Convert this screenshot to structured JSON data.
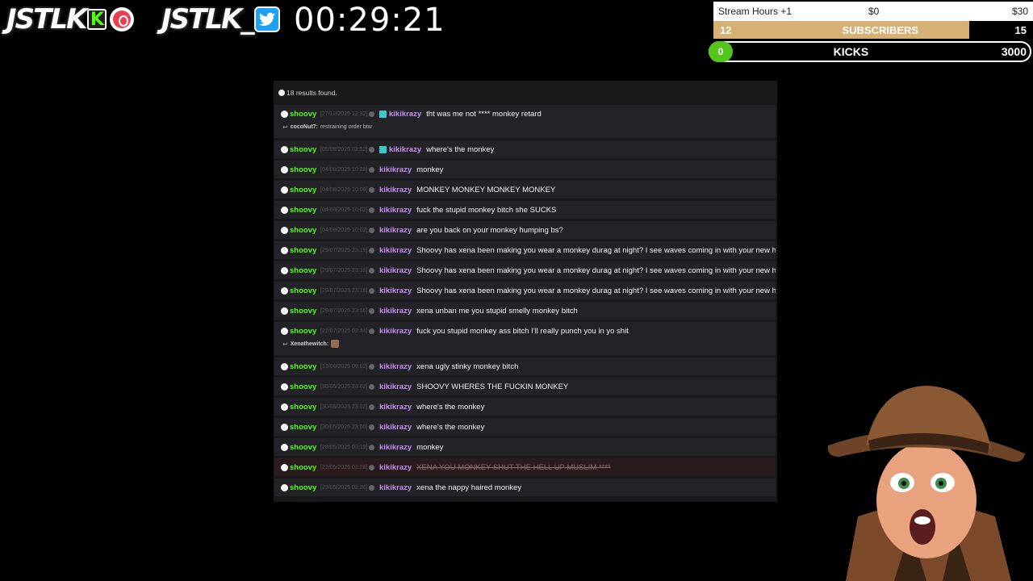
{
  "brand": {
    "logo1": "JSTLK",
    "logo1_badge": "K",
    "logo2": "JSTLK_",
    "timer": "00:29:21"
  },
  "goals": {
    "stream_hours": {
      "title": "Stream Hours +1",
      "current": "$0",
      "target": "$30"
    },
    "subscribers": {
      "current": "12",
      "label": "SUBSCRIBERS",
      "target": "15",
      "fill_fraction": 0.8,
      "fill_color": "#d6b074"
    },
    "kicks": {
      "current": "0",
      "label": "KICKS",
      "target": "3000",
      "pill_color": "#53c41a"
    }
  },
  "search": {
    "results_text": "18 results found.",
    "rows": [
      {
        "channel": "shoovy",
        "time": "[27/12/2025 12:32]",
        "badge": true,
        "user": "kikikrazy",
        "message": "tht was me not **** monkey retard",
        "reply_user": "cocoNut7:",
        "reply_text": "restraining order btw"
      },
      {
        "channel": "shoovy",
        "time": "[05/08/2025 03:52]",
        "badge": true,
        "user": "kikikrazy",
        "message": "where's the monkey"
      },
      {
        "channel": "shoovy",
        "time": "[04/08/2025 10:28]",
        "user": "kikikrazy",
        "message": "monkey"
      },
      {
        "channel": "shoovy",
        "time": "[04/08/2025 10:09]",
        "user": "kikikrazy",
        "message": "MONKEY MONKEY MONKEY MONKEY"
      },
      {
        "channel": "shoovy",
        "time": "[04/08/2025 10:02]",
        "user": "kikikrazy",
        "message": "fuck the stupid monkey bitch she SUCKS"
      },
      {
        "channel": "shoovy",
        "time": "[04/08/2025 10:02]",
        "user": "kikikrazy",
        "message": "are you back on your monkey humping bs?"
      },
      {
        "channel": "shoovy",
        "time": "[29/07/2025 23:19]",
        "user": "kikikrazy",
        "message": "Shoovy has xena been making you wear a monkey durag at night? I see waves coming in with your new hair"
      },
      {
        "channel": "shoovy",
        "time": "[29/07/2025 23:18]",
        "user": "kikikrazy",
        "message": "Shoovy has xena been making you wear a monkey durag at night? I see waves coming in with your new hair"
      },
      {
        "channel": "shoovy",
        "time": "[29/07/2025 23:18]",
        "user": "kikikrazy",
        "message": "Shoovy has xena been making you wear a monkey durag at night? I see waves coming in with your new hair"
      },
      {
        "channel": "shoovy",
        "time": "[29/07/2025 23:16]",
        "user": "kikikrazy",
        "message": "xena unban me you stupid smelly monkey bitch"
      },
      {
        "channel": "shoovy",
        "time": "[22/07/2025 02:44]",
        "user": "kikikrazy",
        "message": "fuck you stupid monkey ass bitch I'll really punch you in yo shit",
        "reply_user": "Xenathewitch:",
        "reply_emote": true
      },
      {
        "channel": "shoovy",
        "time": "[13/06/2025 09:02]",
        "user": "kikikrazy",
        "message": "xena ugly stinky monkey bitch"
      },
      {
        "channel": "shoovy",
        "time": "[30/05/2025 23:02]",
        "user": "kikikrazy",
        "message": "SHOOVY WHERES THE FUCKIN MONKEY"
      },
      {
        "channel": "shoovy",
        "time": "[30/05/2025 23:02]",
        "user": "kikikrazy",
        "message": "where's the monkey"
      },
      {
        "channel": "shoovy",
        "time": "[30/05/2025 23:00]",
        "user": "kikikrazy",
        "message": "where's the monkey"
      },
      {
        "channel": "shoovy",
        "time": "[28/05/2025 03:19]",
        "user": "kikikrazy",
        "message": "monkey"
      },
      {
        "channel": "shoovy",
        "time": "[23/05/2025 02:28]",
        "user": "kikikrazy",
        "message": "XENA YOU MONKEY SHUT THE HELL UP MUSLIM ****",
        "deleted": true
      },
      {
        "channel": "shoovy",
        "time": "[23/05/2025 02:26]",
        "user": "kikikrazy",
        "message": "xena the nappy haired monkey"
      }
    ]
  }
}
